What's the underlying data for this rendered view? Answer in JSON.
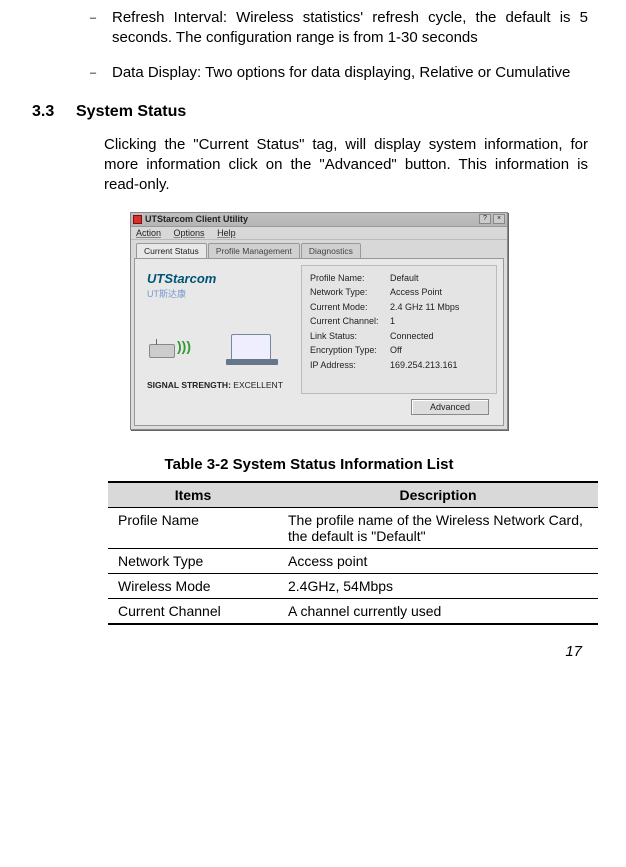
{
  "bullets": [
    {
      "dash": "–",
      "text": "Refresh Interval: Wireless statistics' refresh cycle, the default is 5 seconds. The configuration range is from 1-30 seconds"
    },
    {
      "dash": "–",
      "text": "Data Display: Two options for data displaying, Relative or Cumulative"
    }
  ],
  "section": {
    "number": "3.3",
    "title": "System Status",
    "para": "Clicking the \"Current Status\" tag, will display system information, for more information click on the \"Advanced\" button. This information is read-only."
  },
  "app": {
    "title": "UTStarcom Client Utility",
    "menu": {
      "action": "Action",
      "options": "Options",
      "help": "Help"
    },
    "tabs": {
      "current": "Current Status",
      "profile": "Profile Management",
      "diag": "Diagnostics"
    },
    "logo": {
      "main": "UTStarcom",
      "sub": "UT斯达康"
    },
    "signal": {
      "label": "SIGNAL STRENGTH:",
      "value": "EXCELLENT"
    },
    "fields": {
      "profile_name": {
        "label": "Profile Name:",
        "value": "Default"
      },
      "network_type": {
        "label": "Network Type:",
        "value": "Access Point"
      },
      "current_mode": {
        "label": "Current Mode:",
        "value": "2.4 GHz 11 Mbps"
      },
      "current_channel": {
        "label": "Current Channel:",
        "value": "1"
      },
      "link_status": {
        "label": "Link Status:",
        "value": "Connected"
      },
      "encryption_type": {
        "label": "Encryption Type:",
        "value": "Off"
      },
      "ip_address": {
        "label": "IP Address:",
        "value": "169.254.213.161"
      }
    },
    "advanced_btn": "Advanced"
  },
  "table": {
    "caption": "Table 3-2  System Status Information List",
    "headers": {
      "items": "Items",
      "desc": "Description"
    },
    "rows": [
      {
        "item": "Profile Name",
        "desc": "The profile name of the Wireless Network Card, the default is \"Default\""
      },
      {
        "item": "Network Type",
        "desc": "Access point"
      },
      {
        "item": "Wireless Mode",
        "desc": "2.4GHz, 54Mbps"
      },
      {
        "item": "Current Channel",
        "desc": "A channel currently used"
      }
    ]
  },
  "page_number": "17"
}
